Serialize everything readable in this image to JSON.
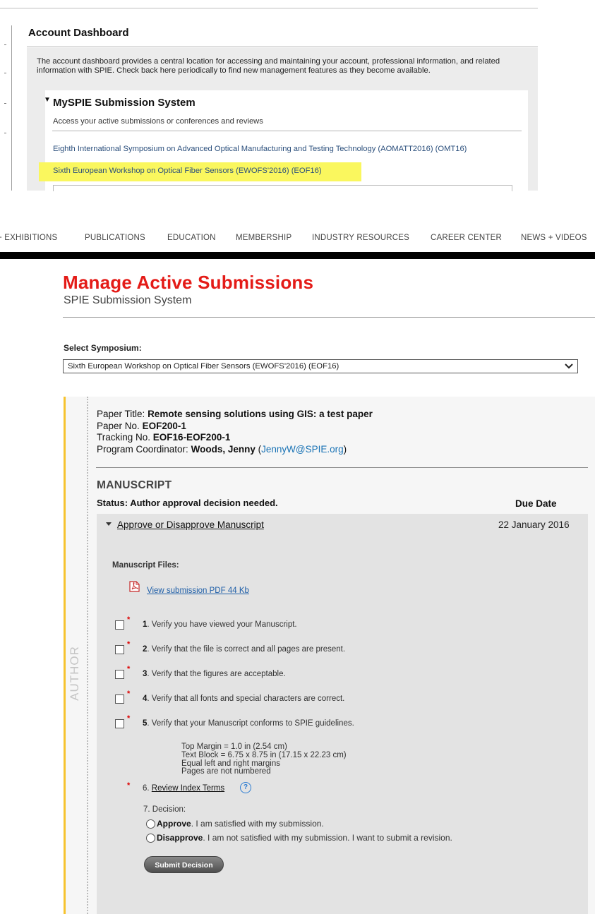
{
  "dashboard": {
    "title": "Account Dashboard",
    "description": "The account dashboard provides a central location for accessing and maintaining your account, professional information, and related information with SPIE. Check back here periodically to find new management features as they become available.",
    "mysp": {
      "title": "MySPIE Submission System",
      "subtitle": "Access your active submissions or conferences and reviews",
      "symposia": [
        "Eighth International Symposium on Advanced Optical Manufacturing and Testing Technology (AOMATT2016) (OMT16)",
        "Sixth European Workshop on Optical Fiber Sensors (EWOFS'2016) (EOF16)"
      ]
    }
  },
  "nav": {
    "items": [
      "+ EXHIBITIONS",
      "PUBLICATIONS",
      "EDUCATION",
      "MEMBERSHIP",
      "INDUSTRY RESOURCES",
      "CAREER CENTER",
      "NEWS + VIDEOS"
    ]
  },
  "page": {
    "title": "Manage Active Submissions",
    "subtitle": "SPIE Submission System",
    "select_label": "Select Symposium:",
    "select_value": "Sixth European Workshop on Optical Fiber Sensors (EWOFS'2016) (EOF16)"
  },
  "paper": {
    "title_label": "Paper Title:",
    "title": "Remote sensing solutions using GIS: a test paper",
    "no_label": "Paper No.",
    "no": "EOF200-1",
    "tracking_label": "Tracking No.",
    "tracking": "EOF16-EOF200-1",
    "coord_label": "Program Coordinator:",
    "coord": "Woods, Jenny",
    "email": "JennyW@SPIE.org"
  },
  "manuscript": {
    "section": "MANUSCRIPT",
    "status": "Status: Author approval decision needed.",
    "due_label": "Due Date",
    "action": "Approve or Disapprove Manuscript",
    "due_date": "22 January 2016",
    "files_label": "Manuscript Files:",
    "pdf_link": "View submission PDF 44 Kb",
    "checks": [
      {
        "num": "1",
        "text": "Verify you have viewed your Manuscript."
      },
      {
        "num": "2",
        "text": "Verify that the file is correct and all pages are present."
      },
      {
        "num": "3",
        "text": "Verify that the figures are acceptable."
      },
      {
        "num": "4",
        "text": "Verify that all fonts and special characters are correct."
      },
      {
        "num": "5",
        "text": "Verify that your Manuscript conforms to SPIE guidelines."
      }
    ],
    "specs": [
      "Top Margin = 1.0 in (2.54 cm)",
      "Text Block = 6.75 x 8.75 in (17.15 x 22.23 cm)",
      "Equal left and right margins",
      "Pages are not numbered"
    ],
    "review_num": "6.",
    "review_link": "Review Index Terms",
    "decision_label": "7. Decision:",
    "approve_bold": "Approve",
    "approve_text": ". I am satisfied with my submission.",
    "disapprove_bold": "Disapprove",
    "disapprove_text": ". I am not satisfied with my submission. I want to submit a revision.",
    "submit": "Submit Decision"
  },
  "author_label": "AUTHOR"
}
